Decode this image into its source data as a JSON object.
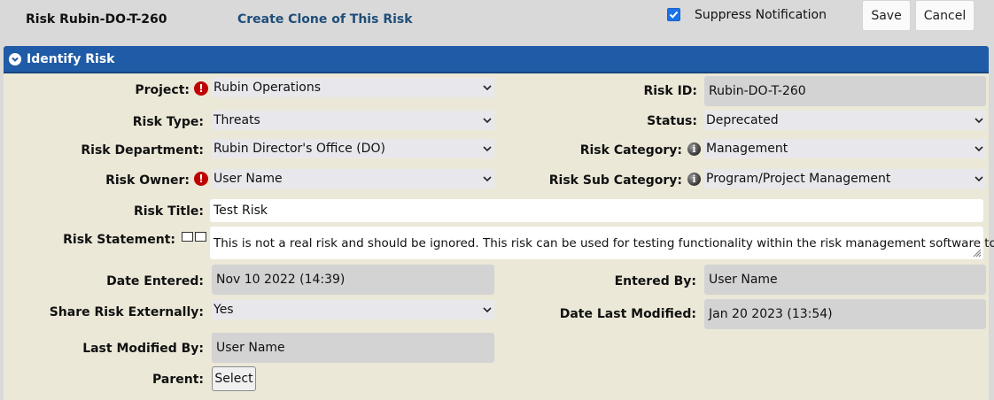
{
  "header": {
    "risk_name": "Risk Rubin-DO-T-260",
    "clone_link": "Create Clone of This Risk",
    "suppress_label": "Suppress Notification",
    "suppress_checked": true,
    "save_label": "Save",
    "cancel_label": "Cancel"
  },
  "section": {
    "title": "Identify Risk"
  },
  "form": {
    "project": {
      "label": "Project:",
      "value": "Rubin Operations"
    },
    "risk_id": {
      "label": "Risk ID:",
      "value": "Rubin-DO-T-260"
    },
    "risk_type": {
      "label": "Risk Type:",
      "value": "Threats"
    },
    "status": {
      "label": "Status:",
      "value": "Deprecated"
    },
    "risk_department": {
      "label": "Risk Department:",
      "value": "Rubin Director's Office (DO)"
    },
    "risk_category": {
      "label": "Risk Category:",
      "value": "Management"
    },
    "risk_owner": {
      "label": "Risk Owner:",
      "value": "User Name"
    },
    "risk_sub_category": {
      "label": "Risk Sub Category:",
      "value": "Program/Project Management"
    },
    "risk_title": {
      "label": "Risk Title:",
      "value": "Test Risk"
    },
    "risk_statement": {
      "label": "Risk Statement:",
      "value": "This is not a real risk and should be ignored. This risk can be used for testing functionality within the risk management software tool."
    },
    "date_entered": {
      "label": "Date Entered:",
      "value": "Nov 10 2022 (14:39)"
    },
    "entered_by": {
      "label": "Entered By:",
      "value": "User Name"
    },
    "share_externally": {
      "label": "Share Risk Externally:",
      "value": "Yes"
    },
    "date_last_modified": {
      "label": "Date Last Modified:",
      "value": "Jan 20 2023 (13:54)"
    },
    "last_modified_by": {
      "label": "Last Modified By:",
      "value": "User Name"
    },
    "parent": {
      "label": "Parent:",
      "button": "Select"
    }
  },
  "icons": {
    "required": "exclamation-icon",
    "info": "info-icon",
    "section_toggle": "chevron-down-circle-icon"
  },
  "colors": {
    "header_blue": "#1f5ba6",
    "panel_bg": "#ebe8d8",
    "link": "#1f4e79",
    "required_red": "#c00000",
    "checkbox_blue": "#1a73e8"
  }
}
